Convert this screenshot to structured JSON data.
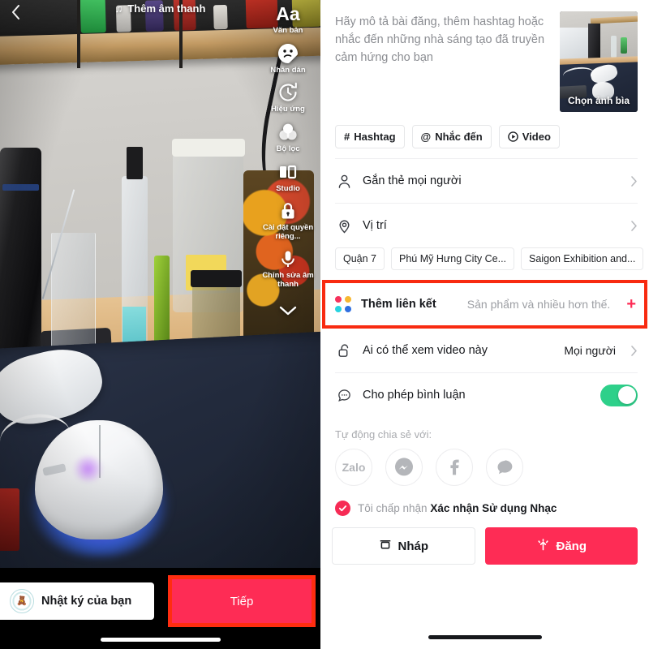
{
  "editor": {
    "sound_button": {
      "label": "Thêm âm thanh",
      "icon": "music-note-icon"
    },
    "back_icon": "back-chevron-icon",
    "tools": [
      {
        "label": "Văn bản",
        "icon": "text-aa-icon",
        "glyph": "Aa"
      },
      {
        "label": "Nhãn dán",
        "icon": "sticker-icon"
      },
      {
        "label": "Hiệu ứng",
        "icon": "effects-icon"
      },
      {
        "label": "Bộ lọc",
        "icon": "filter-icon"
      },
      {
        "label": "Studio",
        "icon": "studio-icon"
      },
      {
        "label": "Cài đặt quyền riêng...",
        "icon": "lock-icon"
      },
      {
        "label": "Chỉnh sửa âm thanh",
        "icon": "microphone-edit-icon"
      }
    ],
    "collapse_icon": "chevron-down-icon",
    "diary_button": {
      "label": "Nhật ký của bạn",
      "avatar_icon": "avatar-icon",
      "avatar_glyph": "🧸"
    },
    "next_button": {
      "label": "Tiếp",
      "highlight_color": "#ff2d10"
    }
  },
  "post": {
    "caption_placeholder": "Hãy mô tả bài đăng, thêm hashtag hoặc nhắc đến những nhà sáng tạo đã truyền cảm hứng cho bạn",
    "cover": {
      "label": "Chọn ảnh bìa"
    },
    "quick_chips": [
      {
        "label": "Hashtag",
        "icon": "hashtag-icon",
        "glyph": "#"
      },
      {
        "label": "Nhắc đến",
        "icon": "mention-icon",
        "glyph": "@"
      },
      {
        "label": "Video",
        "icon": "video-play-icon",
        "glyph": "▶"
      }
    ],
    "tag_people": {
      "label": "Gắn thẻ mọi người",
      "icon": "person-icon",
      "chevron": "chevron-right-icon"
    },
    "location": {
      "label": "Vị trí",
      "icon": "location-pin-icon",
      "chevron": "chevron-right-icon"
    },
    "location_chips": [
      "Quận 7",
      "Phú Mỹ Hưng City Ce...",
      "Saigon Exhibition and..."
    ],
    "add_link": {
      "label": "Thêm liên kết",
      "sub_label": "Sản phẩm và nhiều hơn thế.",
      "plus": "+",
      "icon": "four-dots-icon",
      "highlight_color": "#f82a10",
      "dot_colors": [
        "#f6325c",
        "#f7b731",
        "#27d3e0",
        "#2f6fe0"
      ]
    },
    "privacy": {
      "label": "Ai có thể xem video này",
      "value": "Mọi người",
      "icon": "unlock-icon",
      "chevron": "chevron-right-icon"
    },
    "comments": {
      "label": "Cho phép bình luận",
      "icon": "comment-bubble-icon",
      "enabled": true,
      "toggle_color": "#2ed08a"
    },
    "auto_share": {
      "title": "Tự động chia sẻ với:",
      "targets": [
        {
          "name": "Zalo",
          "icon": "zalo-icon",
          "type": "text"
        },
        {
          "name": "Messenger",
          "icon": "messenger-icon",
          "type": "glyph"
        },
        {
          "name": "Facebook",
          "icon": "facebook-icon",
          "type": "glyph"
        },
        {
          "name": "Chat",
          "icon": "chat-bubble-icon",
          "type": "glyph"
        }
      ]
    },
    "consent": {
      "prefix": "Tôi chấp nhận",
      "link": "Xác nhận Sử dụng Nhạc",
      "checked": true,
      "check_color": "#f62b55"
    },
    "actions": {
      "draft": {
        "label": "Nháp",
        "icon": "draft-box-icon"
      },
      "post": {
        "label": "Đăng",
        "icon": "post-upload-icon",
        "color": "#fe2c55"
      }
    }
  }
}
